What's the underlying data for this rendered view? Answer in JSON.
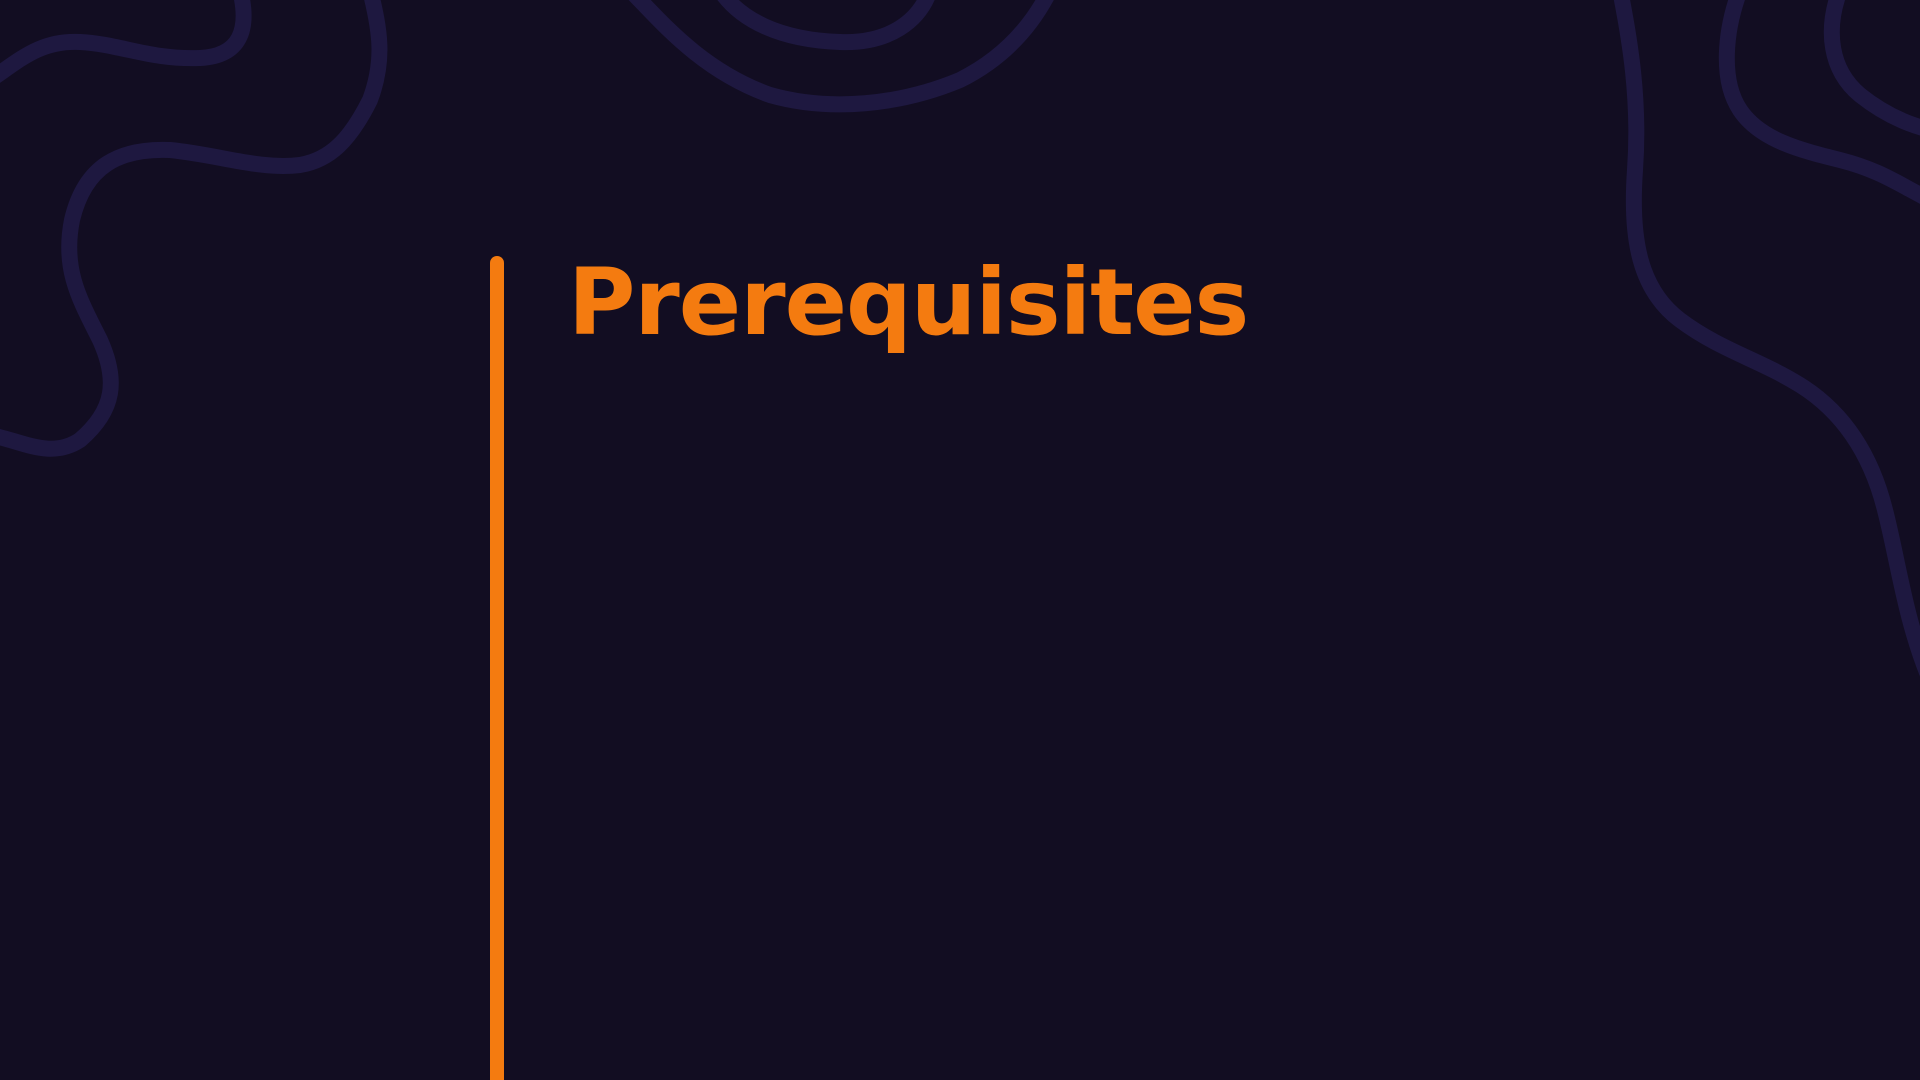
{
  "slide": {
    "title": "Prerequisites",
    "accent_color": "#f47b10",
    "background_color": "#120d22",
    "decoration_color": "#1e1840"
  }
}
